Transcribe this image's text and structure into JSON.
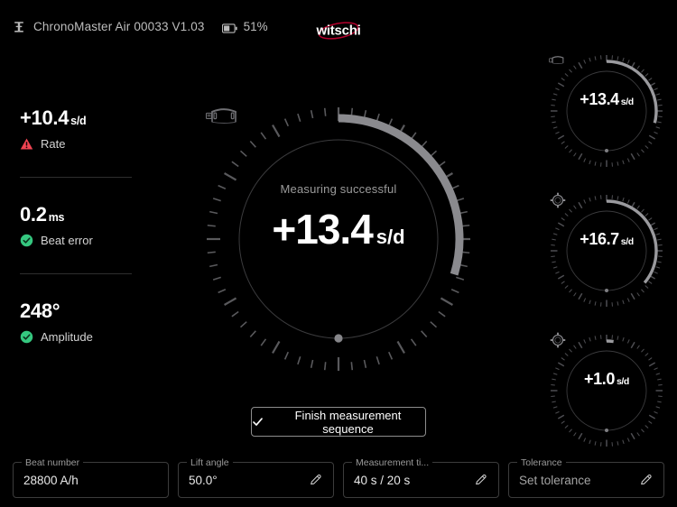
{
  "topbar": {
    "device_icon": "device-tester-icon",
    "device_name": "ChronoMaster Air 00033 V1.03",
    "battery_icon": "battery-icon",
    "battery_level": "51%",
    "battery_percent": 51,
    "brand": "witschi",
    "brand_accent": "#b4002d"
  },
  "stats": [
    {
      "value": "+10.4",
      "unit": "s/d",
      "label": "Rate",
      "status": "warning",
      "status_icon": "warning-triangle-icon",
      "status_color": "#ef4452"
    },
    {
      "value": "0.2",
      "unit": "ms",
      "label": "Beat error",
      "status": "ok",
      "status_icon": "check-circle-icon",
      "status_color": "#35c77f"
    },
    {
      "value": "248°",
      "unit": "",
      "label": "Amplitude",
      "status": "ok",
      "status_icon": "check-circle-icon",
      "status_color": "#35c77f"
    }
  ],
  "main_gauge": {
    "status_text": "Measuring successful",
    "value": "+13.4",
    "unit": "s/d",
    "position_icon": "watch-dial-up-icon",
    "arc_sweep_deg": 107,
    "arc_color": "#8a8a8e",
    "tick_color": "#59595c",
    "marker_dot_angle_deg": 180
  },
  "mini_gauges": [
    {
      "value": "+13.4",
      "unit": "s/d",
      "position_icon": "watch-dial-up-icon",
      "arc_sweep_deg": 104,
      "arc_color": "#9a9a9e"
    },
    {
      "value": "+16.7",
      "unit": "s/d",
      "position_icon": "watch-crown-down-icon",
      "arc_sweep_deg": 130,
      "arc_color": "#9a9a9e"
    },
    {
      "value": "+1.0",
      "unit": "s/d",
      "position_icon": "watch-crown-down-icon",
      "arc_sweep_deg": 8,
      "arc_color": "#9a9a9e"
    }
  ],
  "finish_button": {
    "label": "Finish measurement sequence",
    "icon": "check-icon"
  },
  "fields": [
    {
      "label": "Beat number",
      "value": "28800 A/h",
      "placeholder": "",
      "is_placeholder": false,
      "editable": false
    },
    {
      "label": "Lift angle",
      "value": "50.0°",
      "placeholder": "",
      "is_placeholder": false,
      "editable": true,
      "edit_icon": "pencil-icon"
    },
    {
      "label": "Measurement ti...",
      "value": "40 s / 20 s",
      "placeholder": "",
      "is_placeholder": false,
      "editable": true,
      "edit_icon": "pencil-icon"
    },
    {
      "label": "Tolerance",
      "value": "Set tolerance",
      "placeholder": "Set tolerance",
      "is_placeholder": true,
      "editable": true,
      "edit_icon": "pencil-icon"
    }
  ]
}
